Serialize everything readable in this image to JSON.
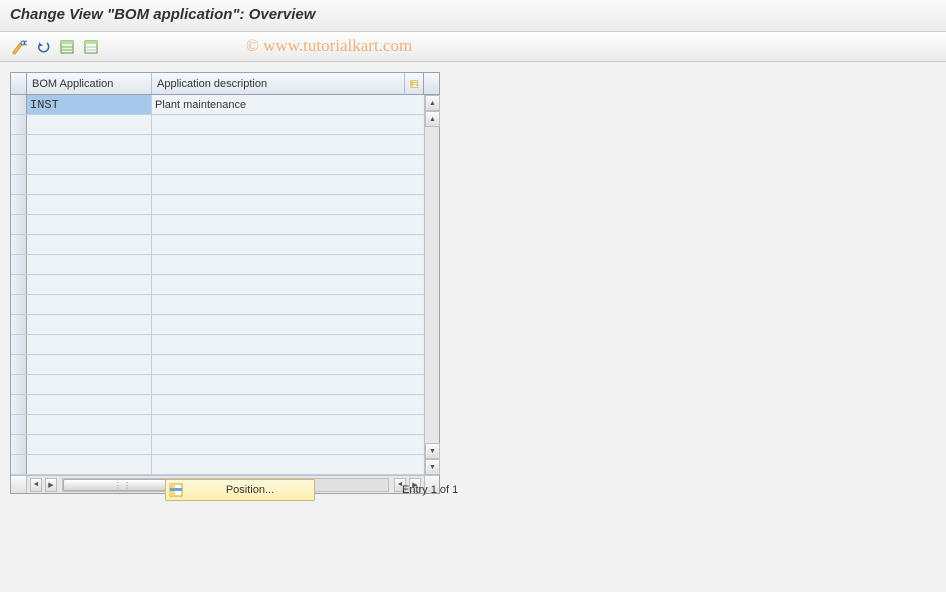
{
  "header": {
    "title": "Change View \"BOM application\": Overview"
  },
  "toolbar": {
    "icons": [
      "toggle-display",
      "undo",
      "select-all",
      "deselect-all"
    ]
  },
  "table": {
    "columns": {
      "bom_app": "BOM Application",
      "app_desc": "Application description"
    },
    "rows": [
      {
        "app": "INST",
        "desc": "Plant maintenance"
      }
    ],
    "empty_rows": 18
  },
  "footer": {
    "position_label": "Position...",
    "entry_text": "Entry 1 of 1"
  },
  "watermark": "© www.tutorialkart.com"
}
